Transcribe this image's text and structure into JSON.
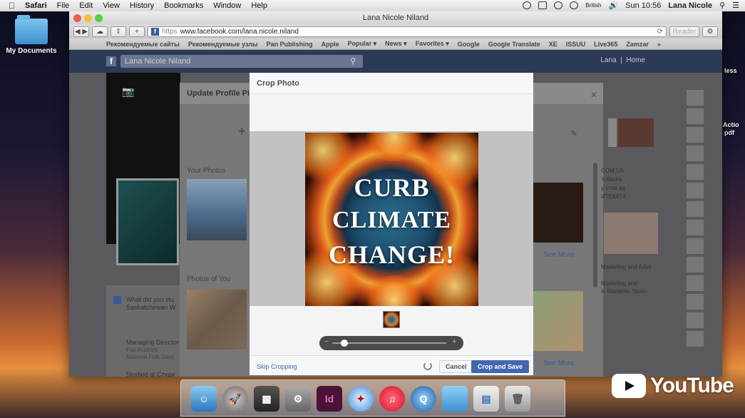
{
  "menubar": {
    "app": "Safari",
    "items": [
      "File",
      "Edit",
      "View",
      "History",
      "Bookmarks",
      "Window",
      "Help"
    ],
    "keyboard": "British",
    "clock": "Sun 10:56",
    "user": "Lana Nicole"
  },
  "desktop": {
    "folder_label": "My Documents",
    "right_labels": [
      "less",
      "Actio",
      "pdf"
    ]
  },
  "window": {
    "title": "Lana Nicole Niland",
    "url_scheme": "https",
    "url": "www.facebook.com/lana.nicole.niland",
    "reader": "Reader"
  },
  "bookmarks": [
    "Рекомендуемые сайты",
    "Рекомендуемые узлы",
    "Pan Publishing",
    "Apple",
    "Popular ▾",
    "News ▾",
    "Favorites ▾",
    "Google",
    "Google Translate",
    "XE",
    "ISSUU",
    "Live365",
    "Zamzar",
    "»"
  ],
  "facebook": {
    "search_value": "Lana Nicole Niland",
    "nav_name": "Lana",
    "nav_home": "Home",
    "update_title": "Update Profile Pic",
    "your_photos": "Your Photos",
    "photos_of_you": "Photos of You",
    "status_prompt": "What did you stu",
    "status_sub": "Saskatchewan W",
    "work1": "Managing Director",
    "work1_sub": "Pan Publishi",
    "work1_sub2": "National Folk Danc",
    "studied": "Studied at Студи",
    "see_more_1": "See More",
    "see_more_2": "See More",
    "right_text": [
      "COM.UA",
      "тобаска",
      "у став ад",
      "ИТЕКАТА",
      "Marketing and Adve",
      "Marketing and",
      "in Marbella, Spain"
    ]
  },
  "crop_dialog": {
    "title": "Crop Photo",
    "poster_lines": [
      "CURB",
      "CLIMATE",
      "CHANGE!"
    ],
    "slider": {
      "minus": "−",
      "plus": "+",
      "zoom_level": 0.08
    },
    "skip": "Skip Cropping",
    "cancel": "Cancel",
    "save": "Crop and Save"
  },
  "dock": [
    "finder-icon",
    "launchpad-icon",
    "photo-icon",
    "preferences-icon",
    "indesign-icon",
    "safari-icon",
    "itunes-icon",
    "quicktime-icon",
    "documents-folder-icon",
    "printer-icon",
    "trash-icon"
  ],
  "dock_indesign_label": "Id",
  "youtube": "YouTube"
}
